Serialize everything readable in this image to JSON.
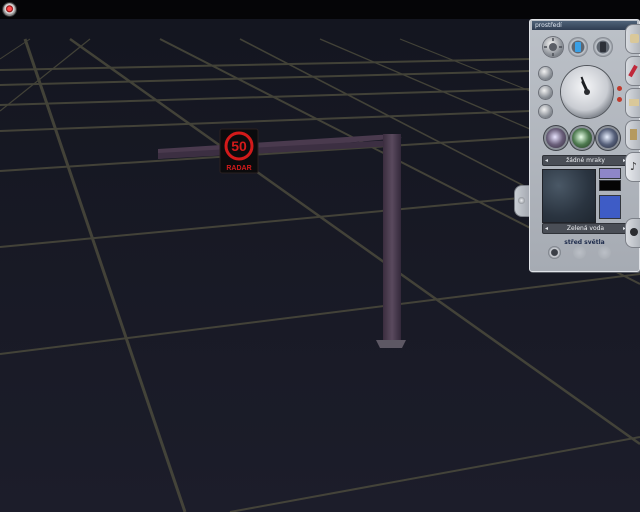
{
  "panel": {
    "title": "prostředí",
    "sky_label": "žádné mraky",
    "water_label": "Zelená voda",
    "light_label": "střed světla"
  },
  "sign": {
    "speed": "50",
    "caption": "RADAR"
  },
  "colors": {
    "sky_top": "#121420",
    "ground": "#1d1e2c",
    "grid_line": "#4b4a3c",
    "gantry": "#4d3c50",
    "sign_red": "#d21a1a",
    "panel_bg": "#b3b8bf",
    "swatch_lavender": "#8e86c8",
    "swatch_black": "#050505",
    "swatch_blue": "#3e5cc6"
  },
  "icons": [
    "close-icon",
    "sun-icon",
    "door-icon",
    "phone-icon",
    "clock-icon",
    "train-icon",
    "brush-icon",
    "gear-icon",
    "cloud-icon",
    "eye-icon"
  ]
}
